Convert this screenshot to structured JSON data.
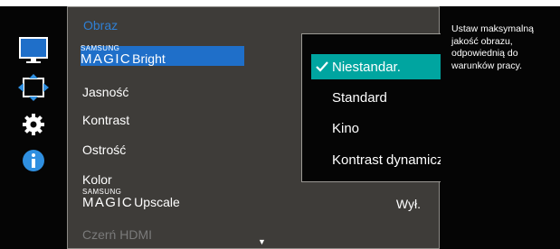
{
  "menu": {
    "title": "Obraz",
    "items": [
      {
        "brand": "SAMSUNG",
        "magic": "MAGIC",
        "label": "Bright",
        "value": ""
      },
      {
        "label": "Jasność",
        "value": ""
      },
      {
        "label": "Kontrast",
        "value": ""
      },
      {
        "label": "Ostrość",
        "value": ""
      },
      {
        "label": "Kolor",
        "value": ""
      },
      {
        "brand": "SAMSUNG",
        "magic": "MAGIC",
        "label": "Upscale",
        "value": "Wył."
      },
      {
        "label": "Czerń HDMI",
        "value": ""
      }
    ],
    "more_indicator": "▼"
  },
  "submenu": {
    "options": [
      {
        "label": "Niestandar.",
        "checked": true
      },
      {
        "label": "Standard",
        "checked": false
      },
      {
        "label": "Kino",
        "checked": false
      },
      {
        "label": "Kontrast dynamiczny",
        "checked": false
      }
    ]
  },
  "help": {
    "text": "Ustaw maksymalną jakość obrazu, odpowiednią do warunków pracy."
  },
  "rail_icons": [
    "monitor-icon",
    "resize-arrows-icon",
    "gear-icon",
    "info-icon"
  ],
  "colors": {
    "menu_title": "#2f7fd3",
    "selected_item": "#1f6fc9",
    "selected_option": "#00a5a0",
    "panel": "#3e3c39",
    "background": "#050505",
    "dimmed_text": "#7a7a7a"
  }
}
